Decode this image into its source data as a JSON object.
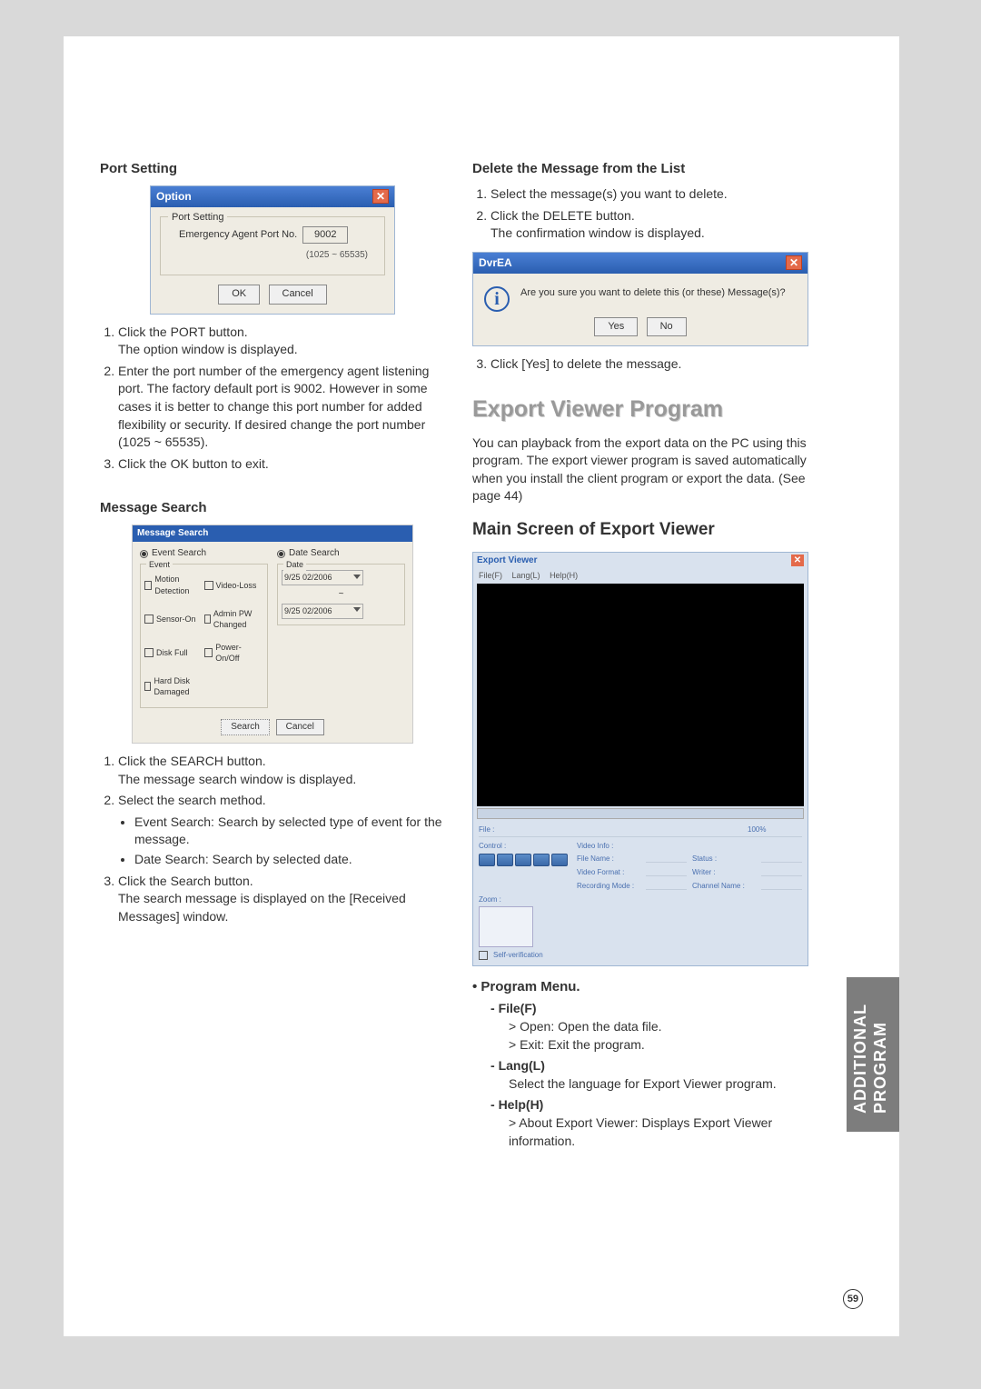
{
  "page_number": "59",
  "side_tab_line1": "ADDITIONAL",
  "side_tab_line2": "PROGRAM",
  "left": {
    "port_setting_title": "Port Setting",
    "option_dialog": {
      "title": "Option",
      "fieldset_label": "Port Setting",
      "port_label": "Emergency Agent Port No.",
      "port_value": "9002",
      "port_range": "(1025 ~ 65535)",
      "ok": "OK",
      "cancel": "Cancel"
    },
    "port_steps": {
      "s1a": "Click the PORT button.",
      "s1b": "The option window is displayed.",
      "s2": "Enter the port number of the emergency agent listening port. The factory default port is 9002. However in some cases it is better to change this port number for added flexibility or security. If desired change the port number (1025 ~ 65535).",
      "s3": "Click the OK button to exit."
    },
    "message_search_title": "Message Search",
    "msg_dialog": {
      "title": "Message Search",
      "event_search": "Event Search",
      "date_search": "Date Search",
      "event_label": "Event",
      "date_label": "Date",
      "cb_motion": "Motion Detection",
      "cb_video_loss": "Video-Loss",
      "cb_sensor_on": "Sensor-On",
      "cb_admin_pwd": "Admin PW Changed",
      "cb_disk_full": "Disk Full",
      "cb_power_onoff": "Power-On/Off",
      "cb_hdd_damaged": "Hard Disk Damaged",
      "date_from": "9/25 02/2006",
      "date_tilde": "~",
      "date_to": "9/25 02/2006",
      "search_btn": "Search",
      "cancel_btn": "Cancel"
    },
    "msg_steps": {
      "s1a": "Click the SEARCH button.",
      "s1b": "The message search window is displayed.",
      "s2": "Select the search method.",
      "s2a": "Event Search: Search by selected type of event for the message.",
      "s2b": "Date Search: Search by selected date.",
      "s3a": "Click the Search button.",
      "s3b": "The search message is displayed on the [Received Messages] window."
    }
  },
  "right": {
    "delete_title": "Delete the Message from the List",
    "delete_steps": {
      "s1": "Select the message(s) you want to delete.",
      "s2a": "Click the DELETE button.",
      "s2b": "The confirmation window is displayed."
    },
    "confirm_dialog": {
      "title": "DvrEA",
      "message": "Are you sure you want to delete this (or these) Message(s)?",
      "yes": "Yes",
      "no": "No"
    },
    "delete_step3": "Click [Yes] to delete the message.",
    "export_title": "Export Viewer Program",
    "export_desc": "You can playback from the export data on the PC using this program. The export viewer program is saved automatically when you install the client program or export the data. (See page 44)",
    "main_screen_title": "Main Screen of Export Viewer",
    "viewer": {
      "title": "Export Viewer",
      "menu_file": "File(F)",
      "menu_lang": "Lang(L)",
      "menu_help": "Help(H)",
      "lbl_file": "File :",
      "lbl_control": "Control :",
      "lbl_zoom": "Zoom :",
      "lbl_self_verify": "Self-verification",
      "lbl_video_info": "Video Info :",
      "lbl_file_name": "File Name :",
      "lbl_video_format": "Video Format :",
      "lbl_recording_mode": "Recording Mode :",
      "lbl_status": "Status :",
      "lbl_writer": "Writer :",
      "lbl_channel": "Channel Name :",
      "lbl_100": "100%"
    },
    "program_menu_title": "Program Menu.",
    "menu": {
      "file_label": "File(F)",
      "file_open": "Open: Open the data file.",
      "file_exit": "Exit: Exit the program.",
      "lang_label": "Lang(L)",
      "lang_desc": "Select the language for Export Viewer program.",
      "help_label": "Help(H)",
      "help_about": "About Export Viewer: Displays Export Viewer information."
    }
  }
}
